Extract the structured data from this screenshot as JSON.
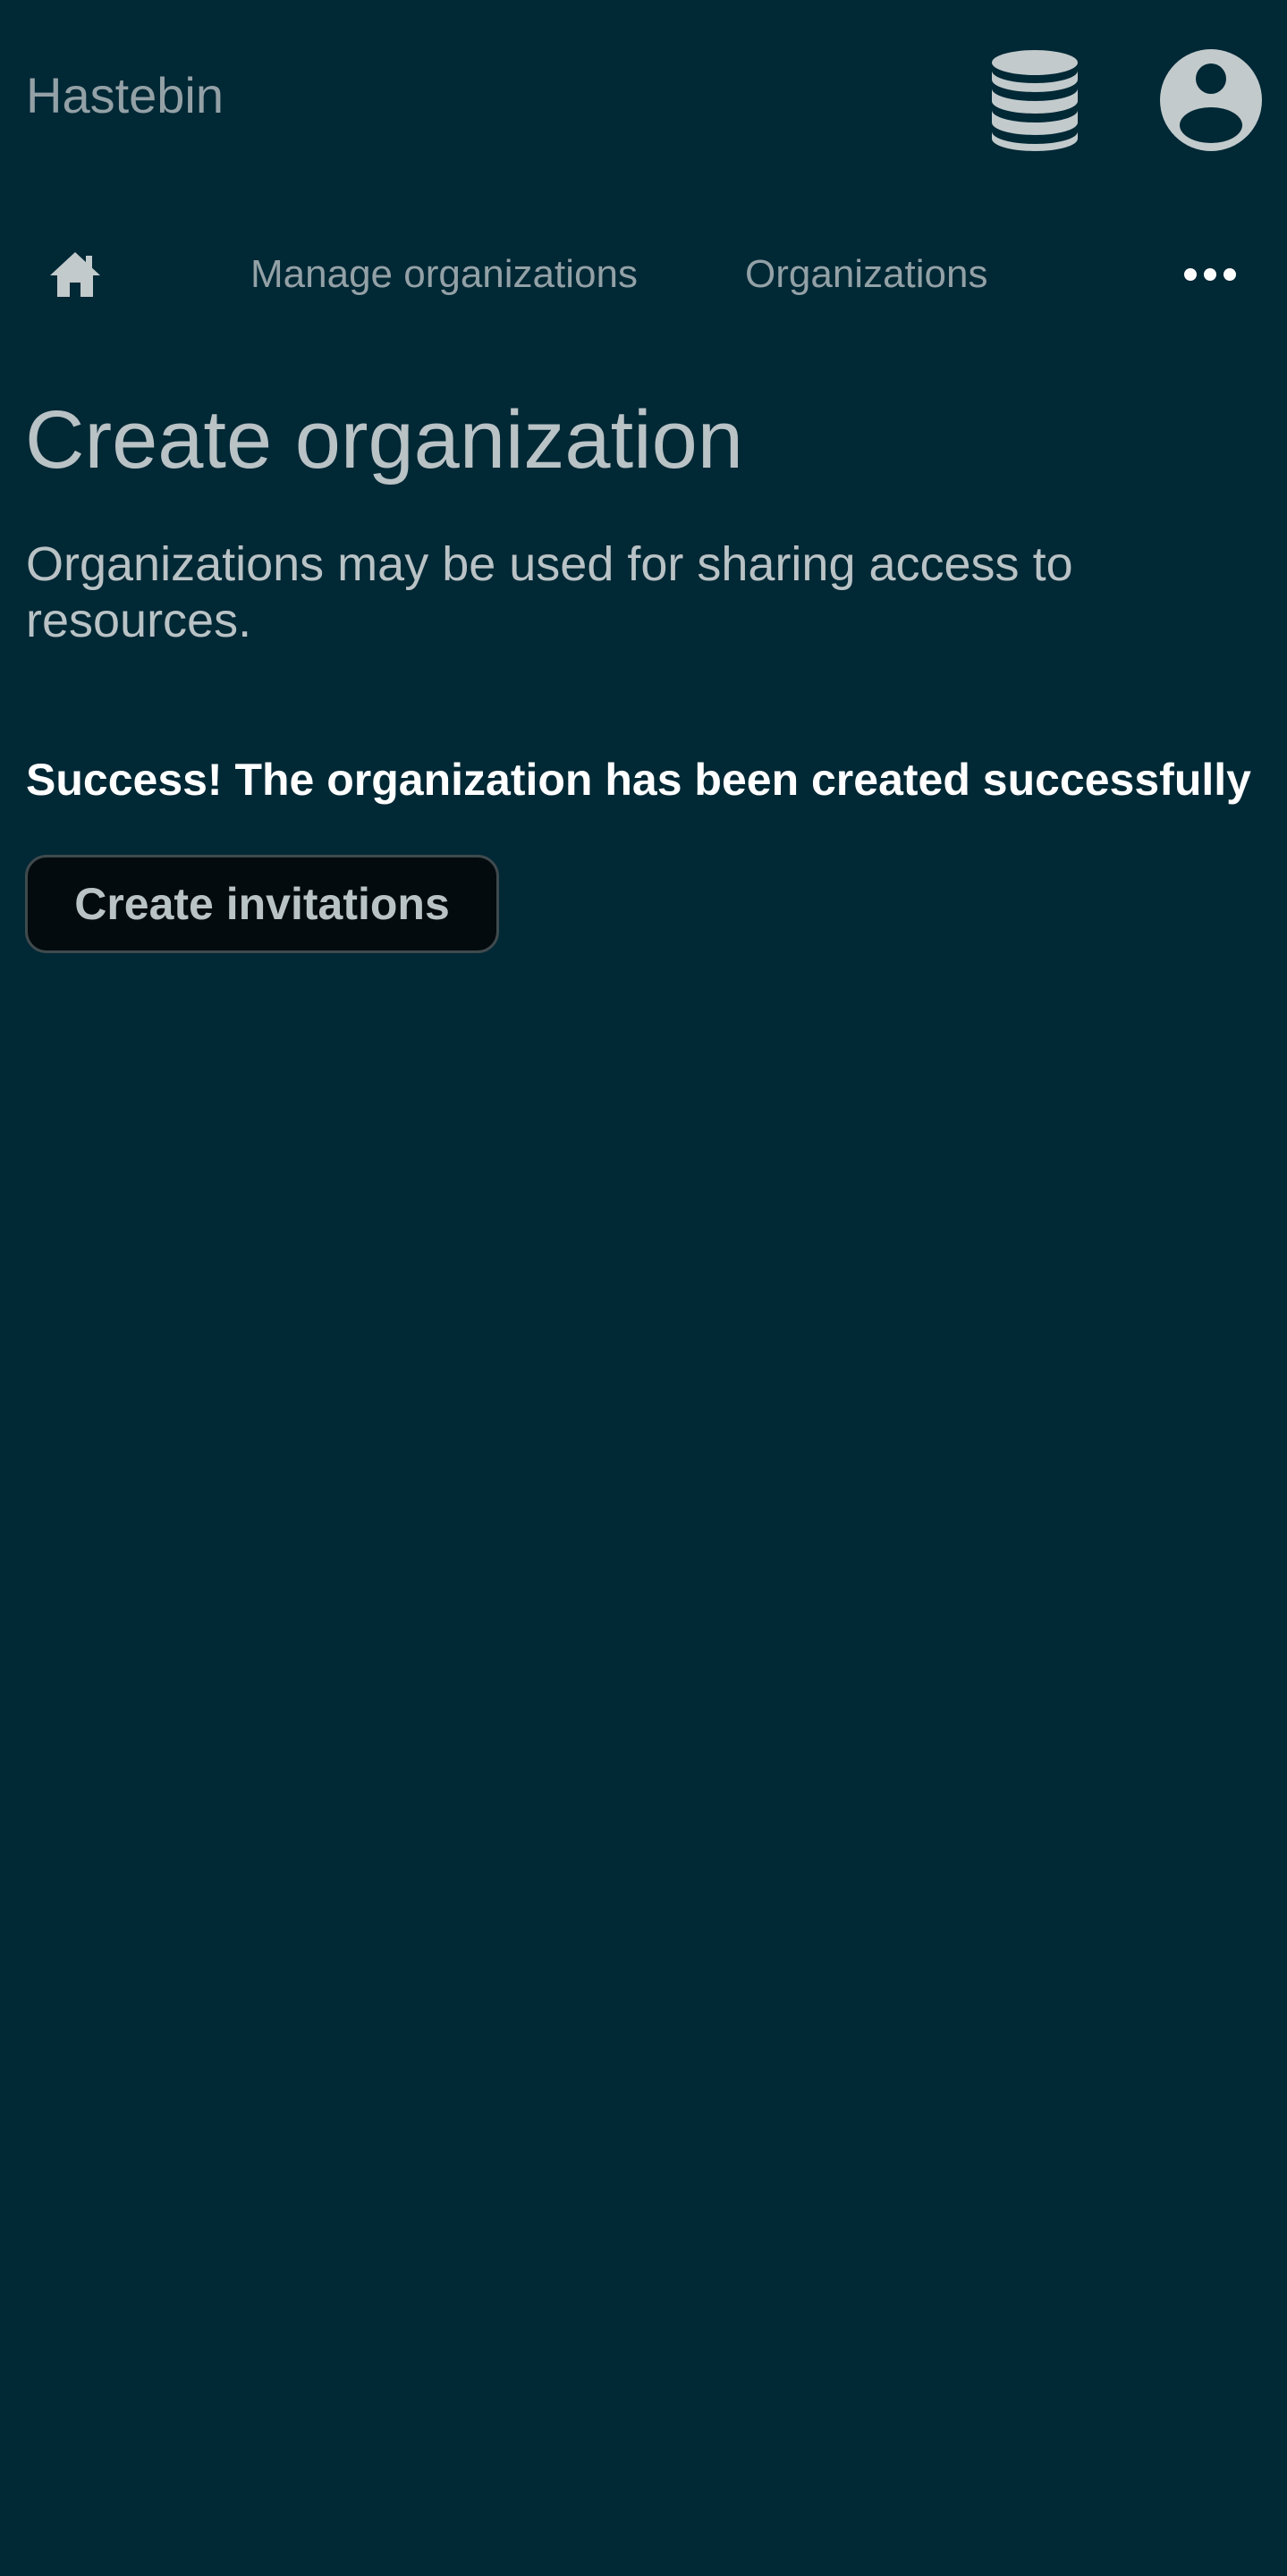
{
  "header": {
    "brand": "Hastebin",
    "icons": {
      "storage": "database-icon",
      "account": "user-circle-icon"
    }
  },
  "nav": {
    "home_icon": "home-icon",
    "links": [
      {
        "label": "Manage organizations"
      },
      {
        "label": "Organizations"
      }
    ],
    "more_icon": "ellipsis-icon"
  },
  "main": {
    "title": "Create organization",
    "description": "Organizations may be used for sharing access to resources.",
    "success_message": "Success! The organization has been created successfully",
    "create_invitations_label": "Create invitations"
  },
  "colors": {
    "background": "#002835",
    "text_muted": "#93a1a6",
    "text": "#b9c2c5",
    "success_text": "#ffffff",
    "button_bg": "#040b0e",
    "icon": "#c2cacc"
  }
}
